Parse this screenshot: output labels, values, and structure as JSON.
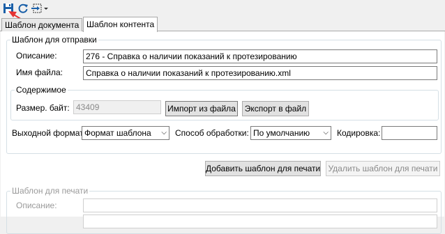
{
  "toolbar": {
    "icons": [
      "save-icon",
      "refresh-icon",
      "import-dropdown-icon"
    ]
  },
  "tabs": [
    {
      "label": "Шаблон документа",
      "active": false
    },
    {
      "label": "Шаблон контента",
      "active": true
    }
  ],
  "send_template": {
    "group_title": "Шаблон для отправки",
    "description_label": "Описание:",
    "description_value": "276 - Справка о наличии показаний к протезированию",
    "filename_label": "Имя файла:",
    "filename_value": "Справка о наличии показаний к протезированию.xml",
    "content_group_title": "Содержимое",
    "size_label": "Размер. байт:",
    "size_value": "43409",
    "import_button": "Импорт из файла",
    "export_button": "Экспорт в файл",
    "output_format_label": "Выходной формат:",
    "output_format_value": "Формат шаблона",
    "processing_label": "Способ обработки:",
    "processing_value": "По умолчанию",
    "encoding_label": "Кодировка:",
    "encoding_value": ""
  },
  "print_actions": {
    "add_button": "Добавить шаблон для печати",
    "delete_button": "Удалить шаблон для печати"
  },
  "print_template": {
    "group_title": "Шаблон для печати",
    "description_label": "Описание:",
    "description_value": ""
  },
  "colors": {
    "accent_icon": "#1a5fa8",
    "annotation_arrow": "#e53333"
  }
}
